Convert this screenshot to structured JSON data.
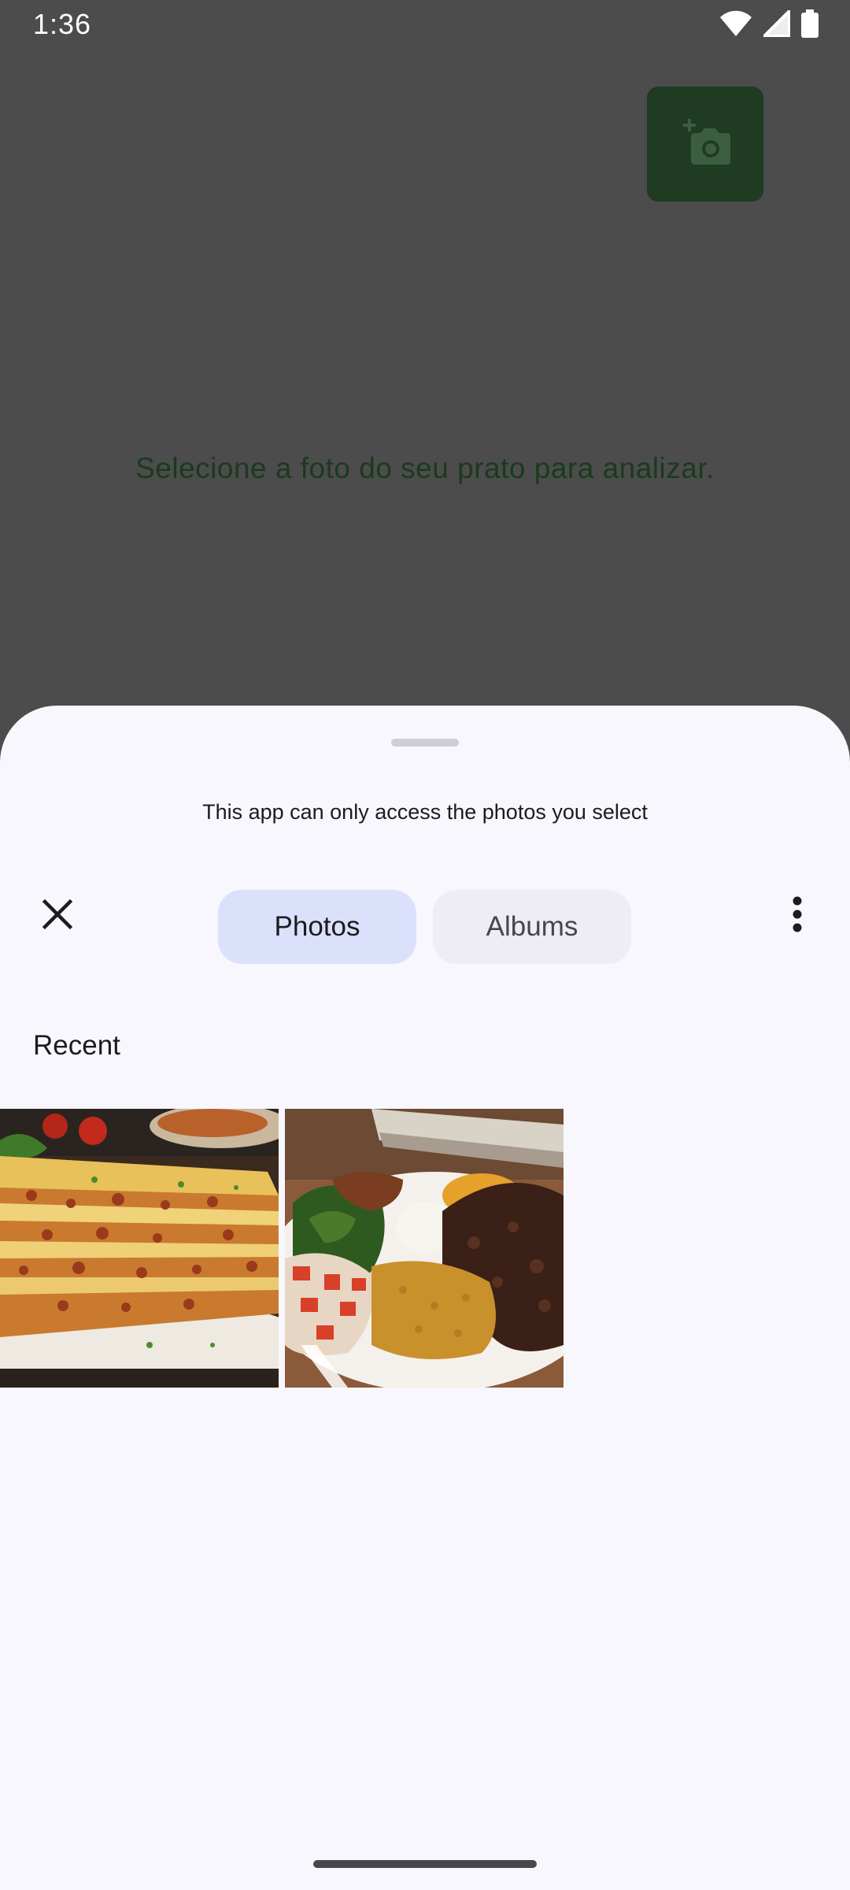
{
  "status_bar": {
    "time": "1:36",
    "icons": [
      "wifi-icon",
      "cell-signal-icon",
      "battery-icon"
    ]
  },
  "app": {
    "camera_button_icon": "add-a-photo-icon",
    "prompt": "Selecione a foto do seu prato para analizar.",
    "accent_color": "#1f3b22"
  },
  "picker": {
    "notice": "This app can only access the photos you select",
    "close_icon": "close-icon",
    "tabs": [
      {
        "label": "Photos",
        "selected": true
      },
      {
        "label": "Albums",
        "selected": false
      }
    ],
    "more_icon": "more-vert-icon",
    "section_title": "Recent",
    "photos": [
      {
        "subject": "lasagna"
      },
      {
        "subject": "feijoada-plate"
      }
    ],
    "selected_tab_color": "#dbe1fb"
  }
}
